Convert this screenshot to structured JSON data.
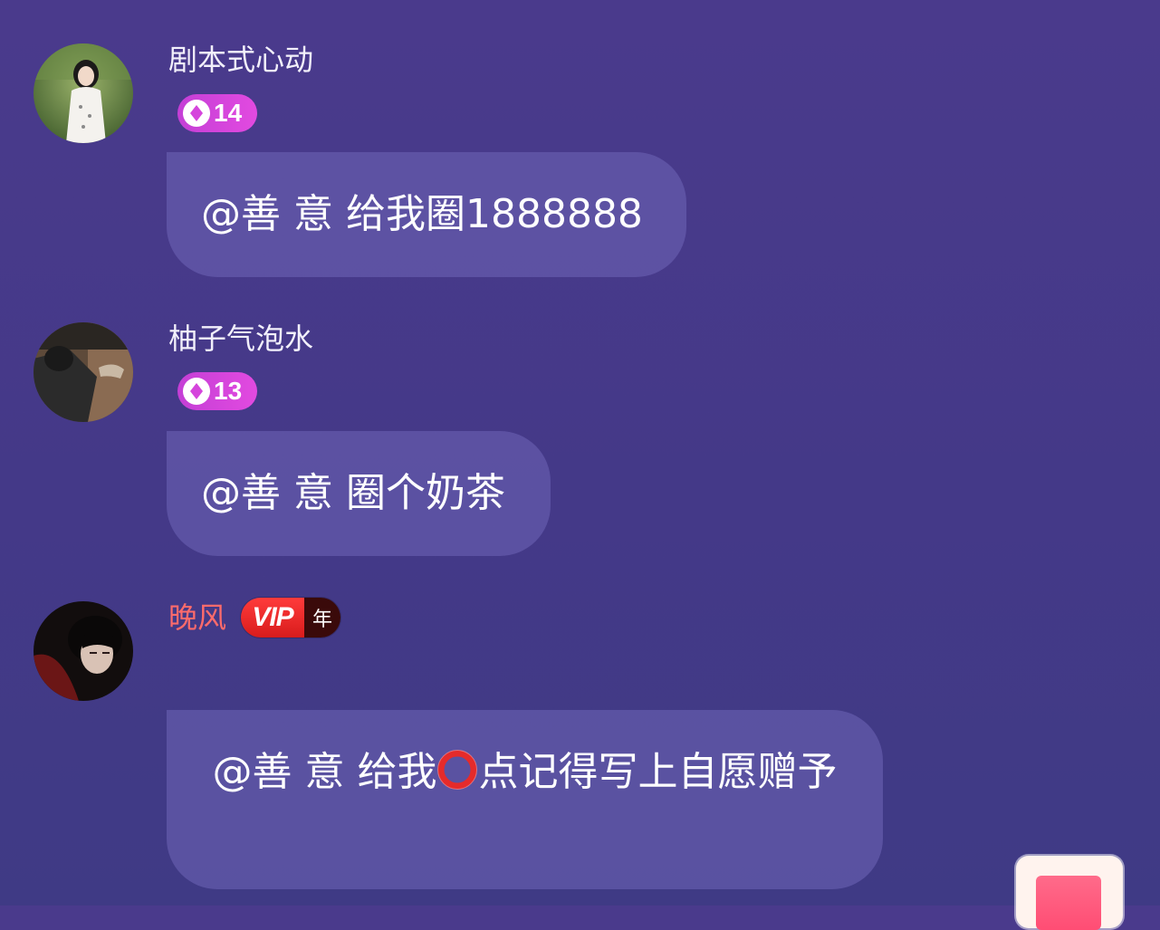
{
  "messages": [
    {
      "username": "剧本式心动",
      "level": "14",
      "text": "@善 意 给我圈1888888"
    },
    {
      "username": "柚子气泡水",
      "level": "13",
      "text": "@善 意 圈个奶茶"
    },
    {
      "username": "晚风",
      "vip_label": "VIP",
      "vip_period": "年",
      "text_before": "@善 意 给我",
      "emoji": "red-ring-emoji",
      "text_after": "点记得写上自愿赠予"
    }
  ],
  "colors": {
    "background": "#463a8a",
    "bubble": "#6f66b6",
    "level_badge": "#d545dc",
    "vip_red": "#e02020",
    "vip_username": "#ff6b6b"
  }
}
